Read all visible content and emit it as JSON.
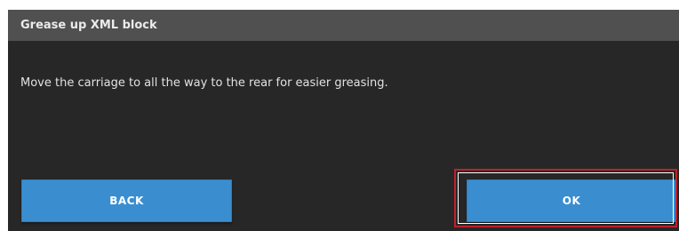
{
  "dialog": {
    "title": "Grease up XML block",
    "message": "Move the carriage to all the way to the rear for easier greasing."
  },
  "buttons": {
    "back_label": "BACK",
    "ok_label": "OK"
  },
  "colors": {
    "dialog_background": "#272727",
    "title_bar": "#505050",
    "button": "#3a8ed0",
    "highlight": "#c0202a"
  }
}
